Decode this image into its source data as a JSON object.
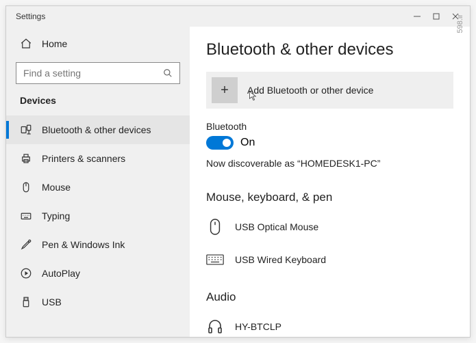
{
  "titlebar": {
    "title": "Settings",
    "watermark": "598.ir"
  },
  "sidebar": {
    "home_label": "Home",
    "search_placeholder": "Find a setting",
    "header": "Devices",
    "items": [
      {
        "label": "Bluetooth & other devices"
      },
      {
        "label": "Printers & scanners"
      },
      {
        "label": "Mouse"
      },
      {
        "label": "Typing"
      },
      {
        "label": "Pen & Windows Ink"
      },
      {
        "label": "AutoPlay"
      },
      {
        "label": "USB"
      }
    ]
  },
  "main": {
    "title": "Bluetooth & other devices",
    "add_device_label": "Add Bluetooth or other device",
    "bluetooth_label": "Bluetooth",
    "bluetooth_state": "On",
    "discoverable_text": "Now discoverable as “HOMEDESK1-PC”",
    "categories": [
      {
        "header": "Mouse, keyboard, & pen",
        "devices": [
          {
            "label": "USB Optical Mouse"
          },
          {
            "label": "USB Wired Keyboard"
          }
        ]
      },
      {
        "header": "Audio",
        "devices": [
          {
            "label": "HY-BTCLP"
          }
        ]
      }
    ]
  }
}
